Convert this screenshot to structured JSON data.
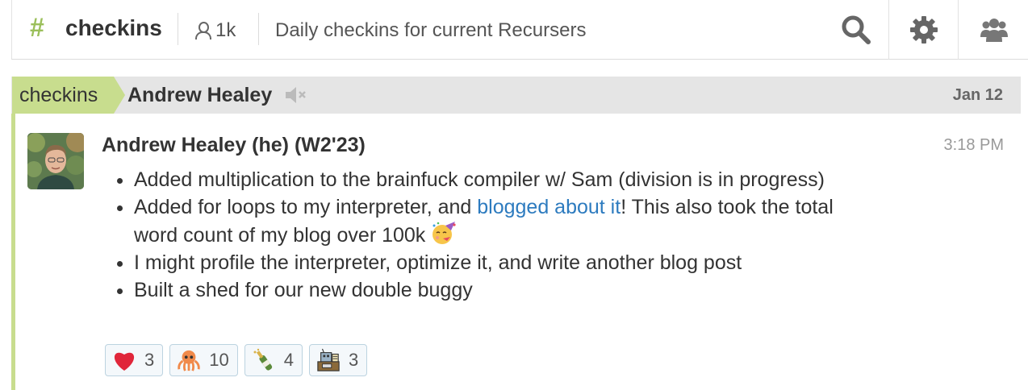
{
  "header": {
    "hash": "#",
    "stream_name": "checkins",
    "subscriber_count": "1k",
    "description": "Daily checkins for current Recursers",
    "icons": [
      "person-icon",
      "search-icon",
      "gear-icon",
      "users-icon"
    ]
  },
  "recipient_bar": {
    "stream": "checkins",
    "topic": "Andrew Healey",
    "muted_icon": "muted-speaker-icon",
    "date": "Jan 12"
  },
  "message": {
    "sender": "Andrew Healey (he) (W2'23)",
    "time": "3:18 PM",
    "items": [
      {
        "text": "Added multiplication to the brainfuck compiler w/ Sam (division is in progress)"
      },
      {
        "before": "Added for loops to my interpreter, and ",
        "link": "blogged about it",
        "after": "! This also took the total word count of my blog over 100k ",
        "emoji": "partying-face-icon"
      },
      {
        "text": "I might profile the interpreter, optimize it, and write another blog post"
      },
      {
        "text": "Built a shed for our new double buggy"
      }
    ]
  },
  "reactions": [
    {
      "emoji": "heart-icon",
      "count": "3"
    },
    {
      "emoji": "octopus-icon",
      "count": "10"
    },
    {
      "emoji": "champagne-icon",
      "count": "4"
    },
    {
      "emoji": "robot-at-desk-icon",
      "count": "3"
    }
  ],
  "colors": {
    "accent": "#9bbf5b",
    "stream_bar": "#c8dd8e",
    "link": "#2d7bbf",
    "recipient_bg": "#e5e5e5"
  }
}
